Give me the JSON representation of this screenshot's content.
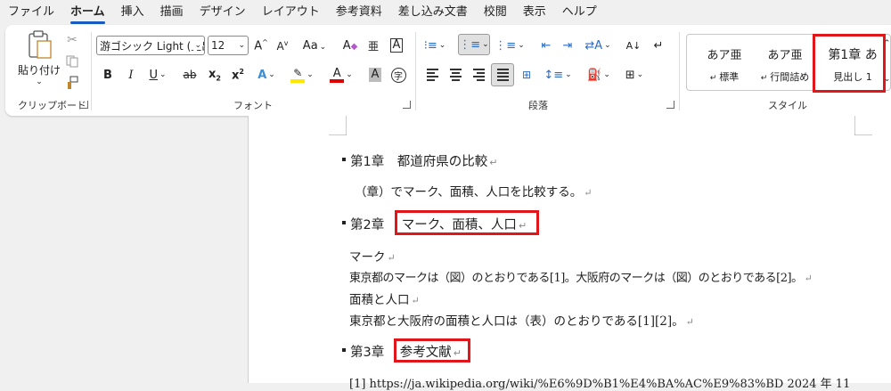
{
  "tabs": [
    "ファイル",
    "ホーム",
    "挿入",
    "描画",
    "デザイン",
    "レイアウト",
    "参考資料",
    "差し込み文書",
    "校閲",
    "表示",
    "ヘルプ"
  ],
  "active_tab": "ホーム",
  "clipboard": {
    "paste_label": "貼り付け",
    "group_label": "クリップボード"
  },
  "font": {
    "name": "游ゴシック Light (見出",
    "size": "12",
    "group_label": "フォント",
    "highlight_color": "#ffe800",
    "font_color": "#e00000"
  },
  "paragraph": {
    "group_label": "段落"
  },
  "styles": {
    "group_label": "スタイル",
    "items": [
      {
        "sample": "あア亜",
        "name": "標準"
      },
      {
        "sample": "あア亜",
        "name": "行間詰め"
      },
      {
        "sample": "第1章",
        "name": "見出し 1"
      }
    ]
  },
  "document": {
    "heading1": {
      "number": "第1章",
      "title": "都道府県の比較"
    },
    "para1": "（章）でマーク、面積、人口を比較する。",
    "heading2": {
      "number": "第2章",
      "title": "マーク、面積、人口"
    },
    "para2": "マーク",
    "para3": "東京都のマークは（図）のとおりである[1]。大阪府のマークは（図）のとおりである[2]。",
    "para4": "面積と人口",
    "para5": "東京都と大阪府の面積と人口は（表）のとおりである[1][2]。",
    "heading3": {
      "number": "第3章",
      "title": "参考文献"
    },
    "ref1": "[1] https://ja.wikipedia.org/wiki/%E6%9D%B1%E4%BA%AC%E9%83%BD  2024 年 11"
  }
}
